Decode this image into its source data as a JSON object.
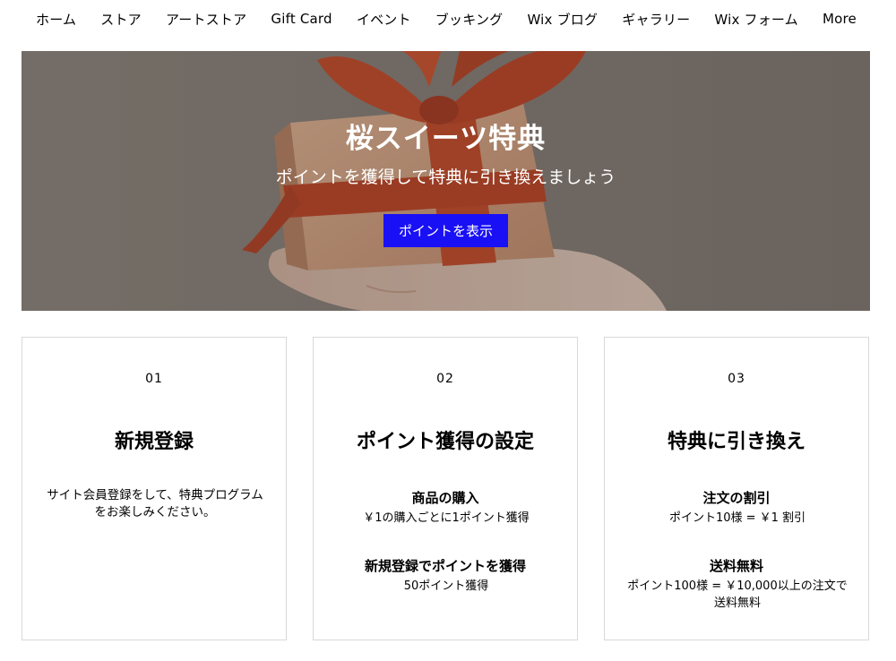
{
  "nav": {
    "items": [
      {
        "label": "ホーム"
      },
      {
        "label": "ストア"
      },
      {
        "label": "アートストア"
      },
      {
        "label": "Gift Card"
      },
      {
        "label": "イベント"
      },
      {
        "label": "ブッキング"
      },
      {
        "label": "Wix ブログ"
      },
      {
        "label": "ギャラリー"
      },
      {
        "label": "Wix フォーム"
      },
      {
        "label": "More"
      }
    ]
  },
  "hero": {
    "title": "桜スイーツ特典",
    "subtitle": "ポイントを獲得して特典に引き換えましょう",
    "button_label": "ポイントを表示"
  },
  "steps": [
    {
      "number": "01",
      "title": "新規登録",
      "text": "サイト会員登録をして、特典プログラムをお楽しみください。"
    },
    {
      "number": "02",
      "title": "ポイント獲得の設定",
      "items": [
        {
          "heading": "商品の購入",
          "description": "￥1の購入ごとに1ポイント獲得"
        },
        {
          "heading": "新規登録でポイントを獲得",
          "description": "50ポイント獲得"
        }
      ]
    },
    {
      "number": "03",
      "title": "特典に引き換え",
      "items": [
        {
          "heading": "注文の割引",
          "description": "ポイント10様 = ￥1 割引"
        },
        {
          "heading": "送料無料",
          "description": "ポイント100様 = ￥10,000以上の注文で送料無料"
        }
      ]
    }
  ],
  "colors": {
    "accent_button": "#1a10f5",
    "ribbon": "#c9411e",
    "card_border": "#d9d9d9"
  }
}
